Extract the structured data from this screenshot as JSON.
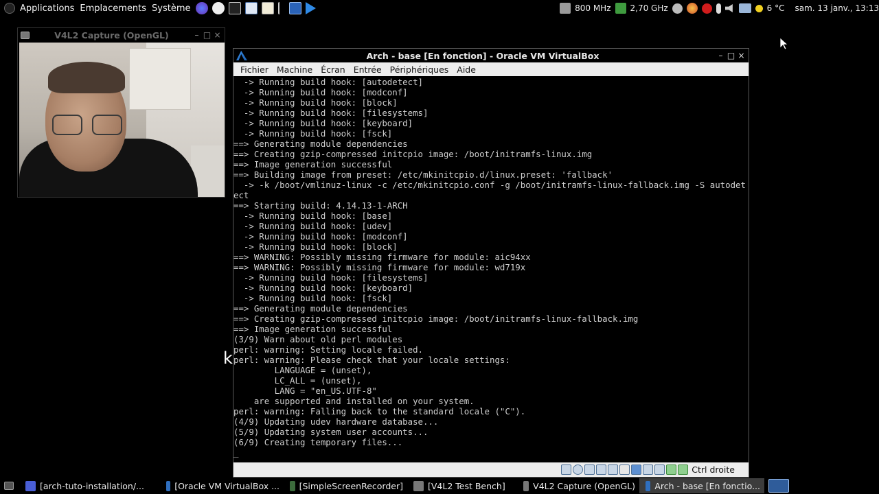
{
  "top_panel": {
    "menus": [
      "Applications",
      "Emplacements",
      "Système"
    ],
    "cpu_freq_1": "800 MHz",
    "cpu_freq_2": "2,70 GHz",
    "weather": "6 °C",
    "datetime": "sam. 13 janv., 13:13"
  },
  "cam_window": {
    "title": "V4L2 Capture (OpenGL)",
    "minimize": "–",
    "maximize": "□",
    "close": "×"
  },
  "vbox": {
    "title": "Arch - base [En fonction] - Oracle VM VirtualBox",
    "minimize": "–",
    "maximize": "□",
    "close": "×",
    "menus": [
      "Fichier",
      "Machine",
      "Écran",
      "Entrée",
      "Périphériques",
      "Aide"
    ],
    "host_key": "Ctrl droite",
    "terminal_lines": [
      "  -> Running build hook: [autodetect]",
      "  -> Running build hook: [modconf]",
      "  -> Running build hook: [block]",
      "  -> Running build hook: [filesystems]",
      "  -> Running build hook: [keyboard]",
      "  -> Running build hook: [fsck]",
      "==> Generating module dependencies",
      "==> Creating gzip-compressed initcpio image: /boot/initramfs-linux.img",
      "==> Image generation successful",
      "==> Building image from preset: /etc/mkinitcpio.d/linux.preset: 'fallback'",
      "  -> -k /boot/vmlinuz-linux -c /etc/mkinitcpio.conf -g /boot/initramfs-linux-fallback.img -S autodet",
      "ect",
      "==> Starting build: 4.14.13-1-ARCH",
      "  -> Running build hook: [base]",
      "  -> Running build hook: [udev]",
      "  -> Running build hook: [modconf]",
      "  -> Running build hook: [block]",
      "==> WARNING: Possibly missing firmware for module: aic94xx",
      "==> WARNING: Possibly missing firmware for module: wd719x",
      "  -> Running build hook: [filesystems]",
      "  -> Running build hook: [keyboard]",
      "  -> Running build hook: [fsck]",
      "==> Generating module dependencies",
      "==> Creating gzip-compressed initcpio image: /boot/initramfs-linux-fallback.img",
      "==> Image generation successful",
      "(3/9) Warn about old perl modules",
      "perl: warning: Setting locale failed.",
      "perl: warning: Please check that your locale settings:",
      "        LANGUAGE = (unset),",
      "        LC_ALL = (unset),",
      "        LANG = \"en_US.UTF-8\"",
      "    are supported and installed on your system.",
      "perl: warning: Falling back to the standard locale (\"C\").",
      "(4/9) Updating udev hardware database...",
      "(5/9) Updating system user accounts...",
      "(6/9) Creating temporary files..."
    ],
    "cursor": "_"
  },
  "stray_char": "k",
  "taskbar": {
    "items": [
      {
        "label": "[arch-tuto-installation/...",
        "icon": "firefox-icon",
        "color": "#4a5fd6"
      },
      {
        "label": "[Oracle VM VirtualBox ...",
        "icon": "virtualbox-icon",
        "color": "#2f6fbf"
      },
      {
        "label": "[SimpleScreenRecorder]",
        "icon": "recorder-icon",
        "color": "#3c6b3c"
      },
      {
        "label": "[V4L2 Test Bench]",
        "icon": "v4l2-icon",
        "color": "#777777"
      },
      {
        "label": "V4L2 Capture (OpenGL)",
        "icon": "v4l2-capture-icon",
        "color": "#777777"
      },
      {
        "label": "Arch - base [En fonctio...",
        "icon": "vbox-arch-icon",
        "color": "#2f6fbf"
      }
    ]
  },
  "colors": {
    "terminal_bg": "#000000",
    "terminal_fg": "#cfcfcf",
    "menubar_bg": "#ededed",
    "vbox_blue": "#2f6fbf"
  }
}
